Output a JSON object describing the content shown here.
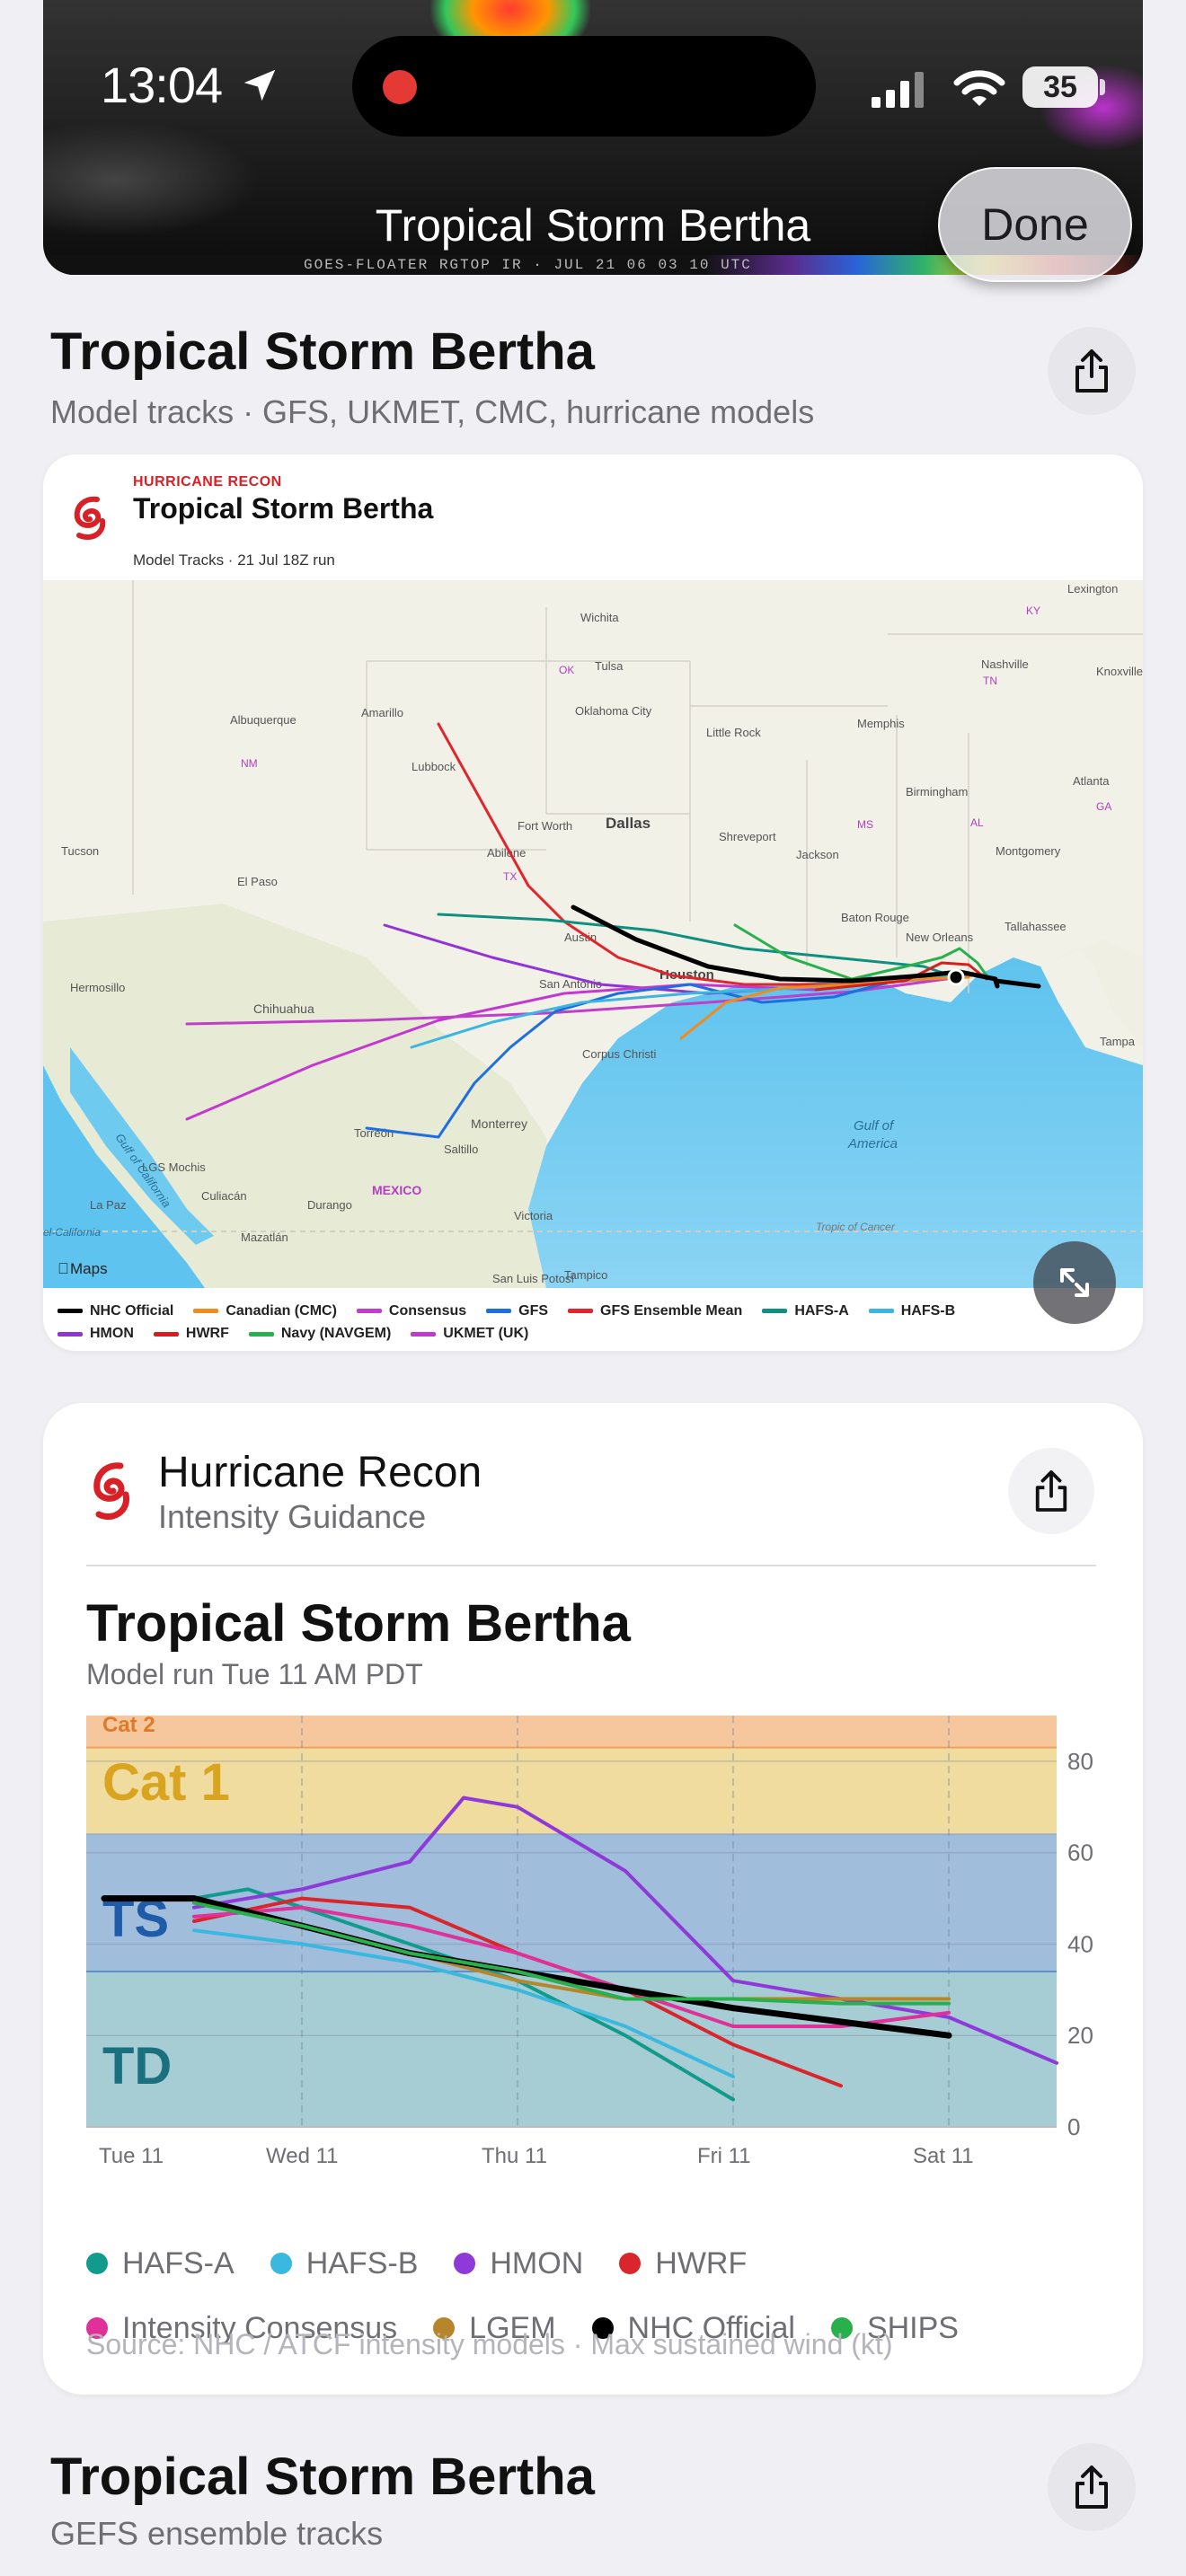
{
  "status_bar": {
    "time": "13:04",
    "battery": "35",
    "icons": [
      "location-arrow-icon",
      "cellular-signal-icon",
      "wifi-icon",
      "battery-icon"
    ]
  },
  "banner": {
    "title": "Tropical Storm Bertha",
    "done_label": "Done",
    "strip_text": "GOES-FLOATER RGTOP IR · JUL 21 06 03 10 UTC"
  },
  "section1": {
    "title": "Tropical Storm Bertha",
    "subtitle": "Model tracks · GFS, UKMET, CMC, hurricane models"
  },
  "tracks_card": {
    "brand": "HURRICANE RECON",
    "title": "Tropical Storm Bertha",
    "run": "Model Tracks · 21 Jul 18Z run",
    "maps_label": "Maps",
    "map_labels": {
      "lexington": "Lexington",
      "ky": "KY",
      "nashville": "Nashville",
      "tn": "TN",
      "knoxville": "Knoxville",
      "wichita": "Wichita",
      "ok": "OK",
      "tulsa": "Tulsa",
      "oklahoma_city": "Oklahoma City",
      "amarillo": "Amarillo",
      "albuquerque": "Albuquerque",
      "memphis": "Memphis",
      "little_rock": "Little Rock",
      "nm": "NM",
      "lubbock": "Lubbock",
      "fort_worth": "Fort Worth",
      "dallas": "Dallas",
      "shreveport": "Shreveport",
      "birmingham": "Birmingham",
      "atlanta": "Atlanta",
      "ga": "GA",
      "ms": "MS",
      "al": "AL",
      "tucson": "Tucson",
      "el_paso": "El Paso",
      "abilene": "Abilene",
      "tx": "TX",
      "jackson": "Jackson",
      "montgomery": "Montgomery",
      "austin": "Austin",
      "baton_rouge": "Baton Rouge",
      "new_orleans": "New Orleans",
      "tallahassee": "Tallahassee",
      "hermosillo": "Hermosillo",
      "san_antonio": "San Antonio",
      "houston": "Houston",
      "chihuahua": "Chihuahua",
      "tampa": "Tampa",
      "corpus_christi": "Corpus Christi",
      "gulf": "Gulf of",
      "america": "America",
      "torreon": "Torreón",
      "monterrey": "Monterrey",
      "saltillo": "Saltillo",
      "los_mochis": "LGS Mochis",
      "culiacan": "Culiacán",
      "mexico": "MEXICO",
      "durango": "Durango",
      "la_paz": "La Paz",
      "mazatlan": "Mazatlán",
      "victoria": "Victoria",
      "tropic": "Tropic of Cancer",
      "san_luis": "San Luis Potosí",
      "tampico": "Tampico",
      "gulf_cal": "Gulf of California",
      "gulf_cal2": "el-California"
    },
    "legend": [
      {
        "name": "NHC Official",
        "color": "#000000"
      },
      {
        "name": "Canadian (CMC)",
        "color": "#f08c1e"
      },
      {
        "name": "Consensus",
        "color": "#c03ec9"
      },
      {
        "name": "GFS",
        "color": "#1e6ee0"
      },
      {
        "name": "GFS Ensemble Mean",
        "color": "#e0262c"
      },
      {
        "name": "HAFS-A",
        "color": "#0f8f80"
      },
      {
        "name": "HAFS-B",
        "color": "#3cb6e0"
      },
      {
        "name": "HMON",
        "color": "#9233d6"
      },
      {
        "name": "HWRF",
        "color": "#d51e1e"
      },
      {
        "name": "Navy (NAVGEM)",
        "color": "#27b04b"
      },
      {
        "name": "UKMET (UK)",
        "color": "#c238d0"
      }
    ]
  },
  "intensity_card": {
    "brand": "Hurricane Recon",
    "subtitle": "Intensity Guidance",
    "title": "Tropical Storm Bertha",
    "run": "Model run Tue 11 AM PDT",
    "source": "Source: NHC / ATCF intensity models · Max sustained wind (kt)"
  },
  "chart_data": {
    "type": "line",
    "title": "Tropical Storm Bertha",
    "subtitle": "Model run Tue 11 AM PDT",
    "ylabel": "",
    "xlabel": "",
    "x": [
      0,
      24,
      48,
      72,
      96,
      108
    ],
    "x_tick_labels": [
      "Tue 11",
      "Wed 11",
      "Thu 11",
      "Fri 11",
      "Sat 11"
    ],
    "x_ticks": [
      0,
      24,
      48,
      72,
      96
    ],
    "ylim": [
      0,
      90
    ],
    "y_ticks": [
      0,
      20,
      40,
      60,
      80
    ],
    "bands": [
      {
        "name": "TD",
        "from": 0,
        "to": 34,
        "color": "#a6cdd4"
      },
      {
        "name": "TS",
        "from": 34,
        "to": 64,
        "color": "#a0bddc"
      },
      {
        "name": "Cat 1",
        "from": 64,
        "to": 83,
        "color": "#f0dc9f"
      },
      {
        "name": "Cat 2",
        "from": 83,
        "to": 90,
        "color": "#f6c79c"
      }
    ],
    "grid": true,
    "legend_position": "bottom",
    "series": [
      {
        "name": "HAFS-A",
        "color": "#119b8c",
        "x": [
          12,
          18,
          24,
          36,
          48,
          60,
          72
        ],
        "y": [
          50,
          52,
          48,
          40,
          32,
          20,
          6
        ]
      },
      {
        "name": "HAFS-B",
        "color": "#39b8e0",
        "x": [
          12,
          24,
          36,
          48,
          60,
          72
        ],
        "y": [
          43,
          40,
          36,
          30,
          22,
          11
        ]
      },
      {
        "name": "HMON",
        "color": "#8e3ad8",
        "x": [
          12,
          24,
          36,
          42,
          48,
          60,
          72,
          84,
          96,
          108
        ],
        "y": [
          48,
          52,
          58,
          72,
          70,
          56,
          32,
          28,
          24,
          14
        ]
      },
      {
        "name": "HWRF",
        "color": "#d8262c",
        "x": [
          12,
          24,
          36,
          48,
          60,
          72,
          84
        ],
        "y": [
          45,
          50,
          48,
          38,
          30,
          18,
          9
        ]
      },
      {
        "name": "Intensity Consensus",
        "color": "#e0309a",
        "x": [
          12,
          24,
          36,
          48,
          60,
          72,
          84,
          96
        ],
        "y": [
          46,
          48,
          44,
          38,
          30,
          22,
          22,
          25
        ]
      },
      {
        "name": "LGEM",
        "color": "#b7862a",
        "x": [
          12,
          24,
          36,
          48,
          60,
          72,
          84,
          96
        ],
        "y": [
          50,
          44,
          38,
          32,
          28,
          28,
          28,
          28
        ]
      },
      {
        "name": "NHC Official",
        "color": "#000000",
        "x": [
          2,
          12,
          24,
          36,
          48,
          60,
          72,
          84,
          96
        ],
        "y": [
          50,
          50,
          44,
          38,
          34,
          30,
          26,
          23,
          20
        ]
      },
      {
        "name": "SHIPS",
        "color": "#27b04b",
        "x": [
          12,
          24,
          36,
          48,
          60,
          72,
          84,
          96
        ],
        "y": [
          49,
          44,
          38,
          34,
          28,
          28,
          27,
          27
        ]
      }
    ]
  },
  "section3": {
    "title": "Tropical Storm Bertha",
    "subtitle": "GEFS ensemble tracks"
  }
}
